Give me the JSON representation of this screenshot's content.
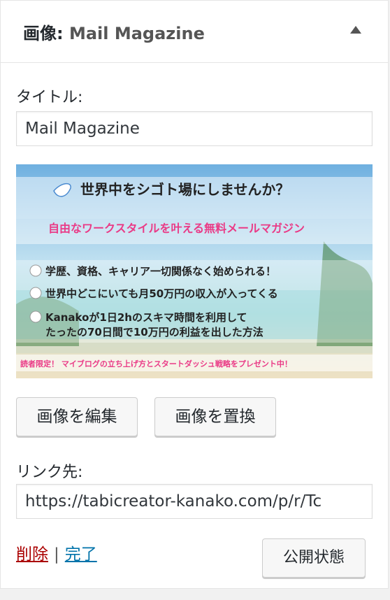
{
  "header": {
    "title_prefix": "画像:",
    "title_name": "Mail Magazine"
  },
  "title_field": {
    "label": "タイトル:",
    "value": "Mail Magazine"
  },
  "banner": {
    "headline": "世界中をシゴト場にしませんか？",
    "subheadline": "自由なワークスタイルを叶える無料メールマガジン",
    "bullets": [
      "学歴、資格、キャリア一切関係なく始められる！",
      "世界中どこにいても月50万円の収入が入ってくる",
      "Kanakoが1日2hのスキマ時間を利用して",
      "たったの70日間で10万円の利益を出した方法"
    ],
    "footer": "読者限定！ マイブログの立ち上げ方とスタートダッシュ戦略をプレゼント中！"
  },
  "buttons": {
    "edit": "画像を編集",
    "replace": "画像を置換",
    "visibility": "公開状態"
  },
  "link_field": {
    "label": "リンク先:",
    "value": "https://tabicreator-kanako.com/p/r/Tc"
  },
  "actions": {
    "delete": "削除",
    "separator": "|",
    "done": "完了"
  }
}
